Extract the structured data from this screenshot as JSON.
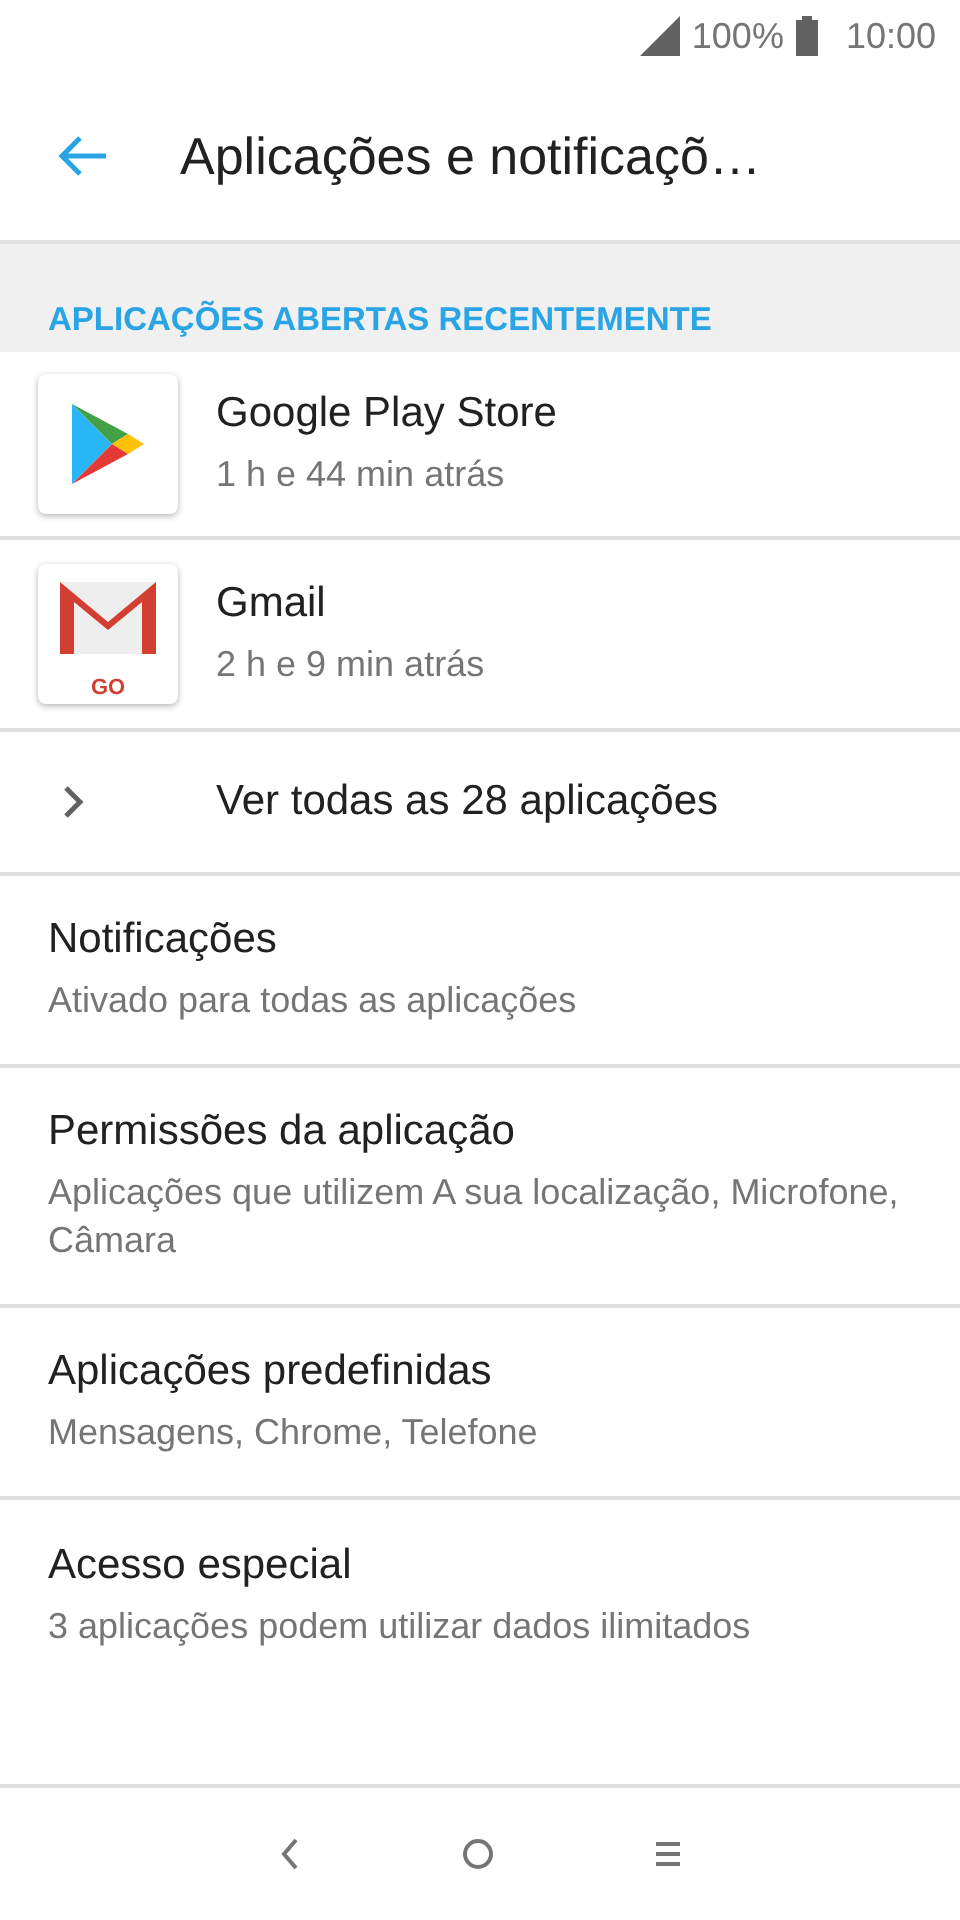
{
  "status_bar": {
    "battery": "100%",
    "time": "10:00"
  },
  "toolbar": {
    "title": "Aplicações e notificaçõ…"
  },
  "section": {
    "header": "APLICAÇÕES ABERTAS RECENTEMENTE"
  },
  "recent_apps": [
    {
      "kind": "play",
      "name": "Google Play Store",
      "time": "1 h e 44 min atrás"
    },
    {
      "kind": "gmail",
      "name": "Gmail",
      "time": "2 h e 9 min atrás",
      "badge": "GO"
    }
  ],
  "see_all": {
    "label": "Ver todas as 28 aplicações"
  },
  "settings": [
    {
      "title": "Notificações",
      "summary": "Ativado para todas as aplicações"
    },
    {
      "title": "Permissões da aplicação",
      "summary": "Aplicações que utilizem A sua localização, Microfone, Câmara"
    },
    {
      "title": "Aplicações predefinidas",
      "summary": "Mensagens, Chrome, Telefone"
    },
    {
      "title": "Acesso especial",
      "summary": "3 aplicações podem utilizar dados ilimitados"
    }
  ]
}
